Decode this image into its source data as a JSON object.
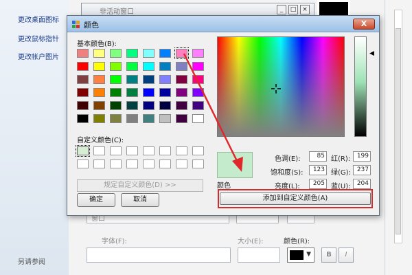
{
  "background": {
    "sidebar_links": [
      "更改桌面图标",
      "更改鼠标指针",
      "更改帐户图片"
    ],
    "sidebar_bottom": "另请参阅",
    "inactive_window_title": "非活动窗口",
    "item_value": "窗口",
    "font_label": "字体(F):",
    "size_label": "大小(E):",
    "color_label": "颜色(R):",
    "bold_button": "B",
    "italic_button": "I"
  },
  "dialog": {
    "title": "颜色",
    "close_label": "X",
    "basic_colors_label": "基本颜色(B):",
    "basic_colors": [
      "#f08080",
      "#ffff80",
      "#80ff80",
      "#00ff80",
      "#80ffff",
      "#0080ff",
      "#ff80c0",
      "#ff80ff",
      "#ff0000",
      "#ffff00",
      "#80ff00",
      "#00ff40",
      "#00ffff",
      "#0080c0",
      "#8080c0",
      "#ff00ff",
      "#804040",
      "#ff8040",
      "#00ff00",
      "#008080",
      "#004080",
      "#8080ff",
      "#800040",
      "#ff0080",
      "#800000",
      "#ff8000",
      "#008000",
      "#008040",
      "#0000ff",
      "#0000a0",
      "#800080",
      "#8000ff",
      "#400000",
      "#804000",
      "#004000",
      "#004040",
      "#000080",
      "#000040",
      "#400040",
      "#400080",
      "#000000",
      "#808000",
      "#808040",
      "#808080",
      "#408080",
      "#c0c0c0",
      "#400040",
      "#ffffff"
    ],
    "custom_colors_label": "自定义颜色(C):",
    "custom_colors": [
      "#d6ecd3",
      "#ffffff",
      "#ffffff",
      "#ffffff",
      "#ffffff",
      "#ffffff",
      "#ffffff",
      "#ffffff",
      "#ffffff",
      "#ffffff",
      "#ffffff",
      "#ffffff",
      "#ffffff",
      "#ffffff",
      "#ffffff",
      "#ffffff"
    ],
    "define_custom_button": "规定自定义颜色(D) >>",
    "ok_button": "确定",
    "cancel_button": "取消",
    "preview_label": "颜色",
    "hue_label": "色调(E):",
    "hue_value": "85",
    "sat_label": "饱和度(S):",
    "sat_value": "123",
    "lum_label": "亮度(L):",
    "lum_value": "205",
    "red_label": "红(R):",
    "red_value": "199",
    "green_label": "绿(G):",
    "green_value": "237",
    "blue_label": "蓝(U):",
    "blue_value": "204",
    "add_custom_button": "添加到自定义颜色(A)",
    "preview_color": "#c4ebcb",
    "highlight_color": "#cf2e2e",
    "annotation_arrow_color": "#e0282a"
  }
}
